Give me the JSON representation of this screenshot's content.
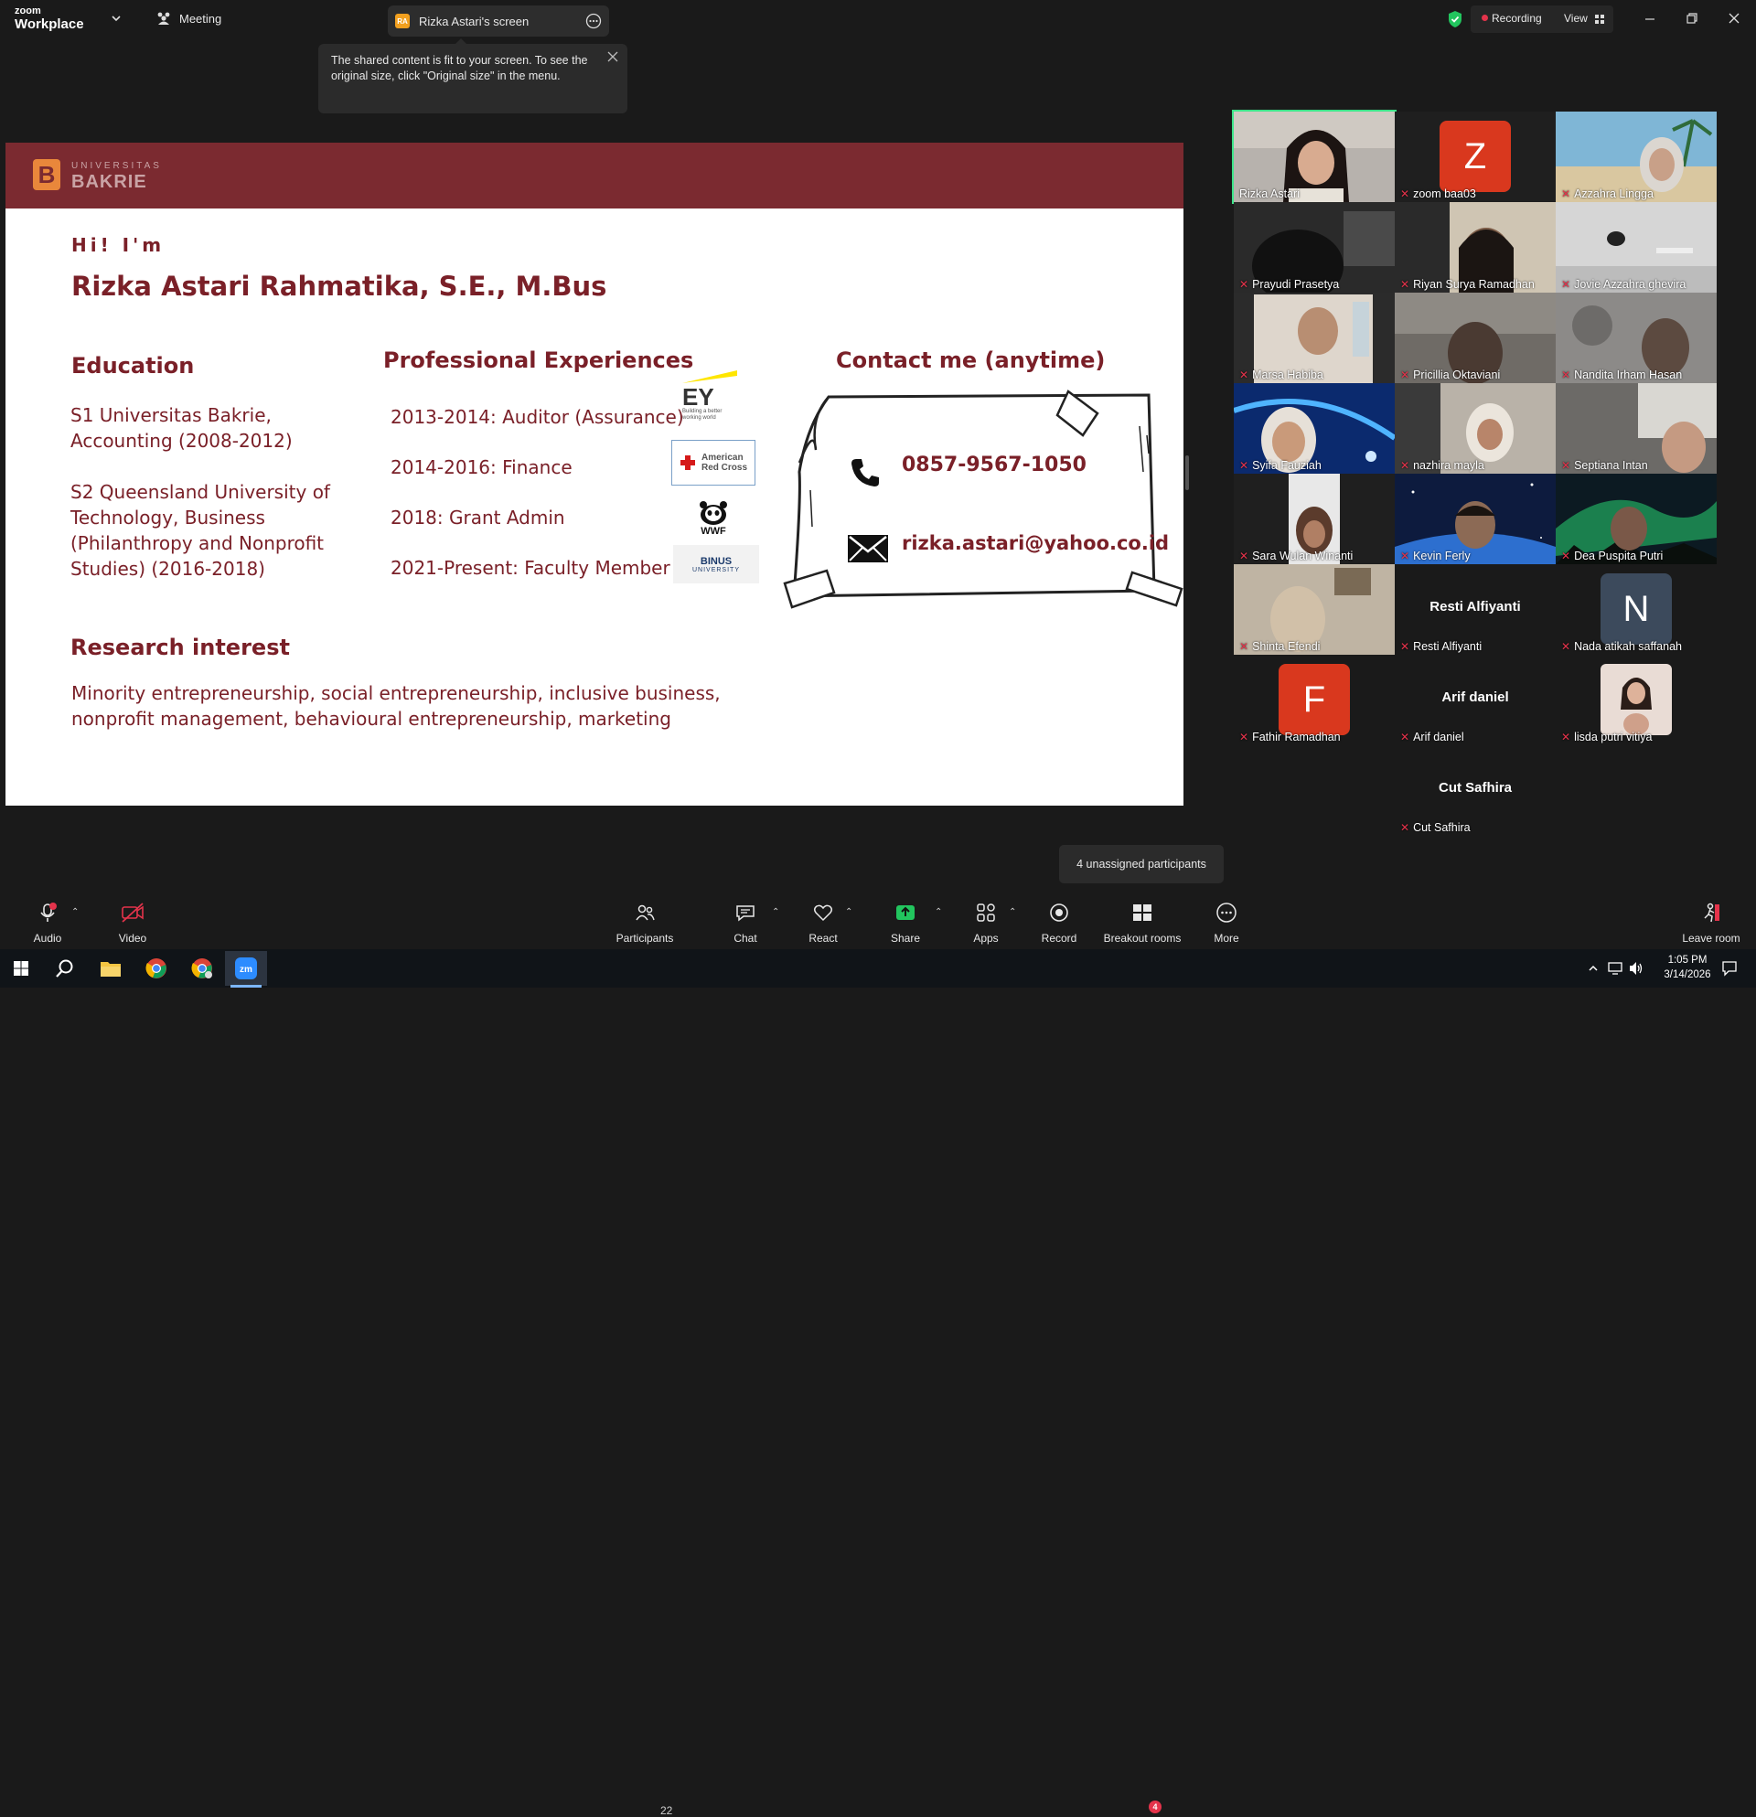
{
  "titlebar": {
    "app_brand_small": "zoom",
    "app_brand": "Workplace",
    "meeting_label": "Meeting",
    "share_initials": "RA",
    "share_title": "Rizka Astari's screen",
    "recording_label": "Recording",
    "view_label": "View"
  },
  "tooltip": {
    "text": "The shared content is fit to your screen. To see the original size, click \"Original size\" in the menu."
  },
  "slide": {
    "logo_top": "UNIVERSITAS",
    "logo_bottom": "BAKRIE",
    "greeting": "Hi! I'm",
    "name": "Rizka Astari Rahmatika, S.E., M.Bus",
    "education_title": "Education",
    "education_1_line1": "S1 Universitas Bakrie,",
    "education_1_line2": "Accounting (2008-2012)",
    "education_2_line1": "S2 Queensland University of",
    "education_2_line2": "Technology, Business",
    "education_2_line3": "(Philanthropy and Nonprofit",
    "education_2_line4": "Studies) (2016-2018)",
    "experience_title": "Professional Experiences",
    "experiences": [
      "2013-2014: Auditor (Assurance)",
      "2014-2016: Finance",
      "2018: Grant Admin",
      "2021-Present: Faculty Member"
    ],
    "ey_logo": "EY",
    "ey_tagline": "Building a better working world",
    "redcross_line1": "American",
    "redcross_line2": "Red Cross",
    "wwf_logo": "WWF",
    "binus_line1": "BINUS",
    "binus_line2": "UNIVERSITY",
    "contact_title": "Contact me (anytime)",
    "phone": "0857-9567-1050",
    "email": "rizka.astari@yahoo.co.id",
    "research_title": "Research interest",
    "research_line1": "Minority entrepreneurship, social entrepreneurship, inclusive business,",
    "research_line2": "nonprofit management, behavioural entrepreneurship, marketing"
  },
  "gallery": {
    "tiles": [
      {
        "name": "Rizka Astari"
      },
      {
        "name": "zoom baa03",
        "initial": "Z"
      },
      {
        "name": "Azzahra Lingga"
      },
      {
        "name": "Prayudi Prasetya"
      },
      {
        "name": "Riyan Surya Ramadhan"
      },
      {
        "name": "Jovie Azzahra ghevira"
      },
      {
        "name": "Marsa Habiba"
      },
      {
        "name": "Pricillia Oktaviani"
      },
      {
        "name": "Nandita Irham Hasan"
      },
      {
        "name": "Syifa Fauziah"
      },
      {
        "name": "nazhira mayla"
      },
      {
        "name": "Septiana Intan"
      },
      {
        "name": "Sara Wulan Winanti"
      },
      {
        "name": "Kevin Ferly"
      },
      {
        "name": "Dea Puspita Putri"
      },
      {
        "name": "Shinta Efendi"
      },
      {
        "name": "Resti Alfiyanti"
      },
      {
        "name": "Nada atikah saffanah",
        "initial": "N"
      },
      {
        "name": "Fathir Ramadhan",
        "initial": "F"
      },
      {
        "name": "Arif daniel"
      },
      {
        "name": "lisda putri vitiya"
      },
      {
        "name": "Cut Safhira"
      }
    ]
  },
  "unassigned_tooltip": "4 unassigned participants",
  "toolbar": {
    "audio": "Audio",
    "video": "Video",
    "participants": "Participants",
    "participants_count": "22",
    "chat": "Chat",
    "react": "React",
    "share": "Share",
    "apps": "Apps",
    "record": "Record",
    "breakout": "Breakout rooms",
    "breakout_badge": "4",
    "more": "More",
    "leave": "Leave room"
  },
  "taskbar": {
    "time": "1:05 PM",
    "date": "3/14/2026"
  },
  "colors": {
    "slide_header": "#7b2a30",
    "slide_text": "#7a2028",
    "share_green": "#22c55e",
    "recording_red": "#e4334b",
    "avatar_red": "#d9381e",
    "avatar_slate": "#3c4a5c",
    "active_border": "#3ee58a"
  }
}
